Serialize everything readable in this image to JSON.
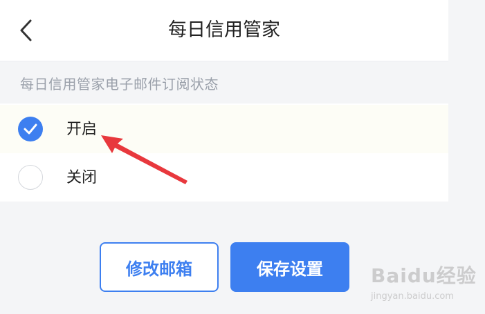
{
  "header": {
    "title": "每日信用管家",
    "back_icon": "chevron-left-icon"
  },
  "section": {
    "label": "每日信用管家电子邮件订阅状态"
  },
  "options": [
    {
      "label": "开启",
      "checked": true
    },
    {
      "label": "关闭",
      "checked": false
    }
  ],
  "buttons": {
    "modify_email": "修改邮箱",
    "save_settings": "保存设置"
  },
  "watermark": {
    "main": "Baidu经验",
    "sub": "jingyan.baidu.com"
  },
  "colors": {
    "accent": "#3d7ff0",
    "annotation_arrow": "#e8383d"
  }
}
